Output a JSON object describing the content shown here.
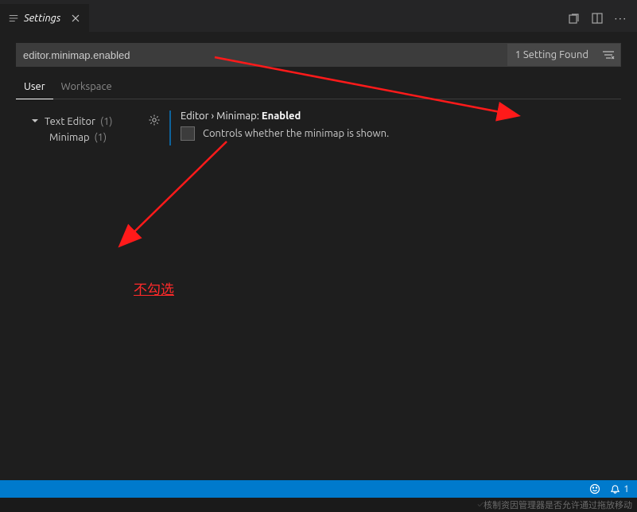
{
  "tab": {
    "title": "Settings"
  },
  "search": {
    "value": "editor.minimap.enabled",
    "result_count": "1 Setting Found"
  },
  "scope": {
    "user": "User",
    "workspace": "Workspace"
  },
  "tree": {
    "root_label": "Text Editor",
    "root_count": "(1)",
    "child_label": "Minimap",
    "child_count": "(1)"
  },
  "setting": {
    "path_prefix": "Editor › Minimap: ",
    "name": "Enabled",
    "description": "Controls whether the minimap is shown."
  },
  "annotation": "不勾选",
  "status": {
    "bell_count": "1"
  },
  "bottom_text": "核制资因管理器是否允许通过拖放移动"
}
